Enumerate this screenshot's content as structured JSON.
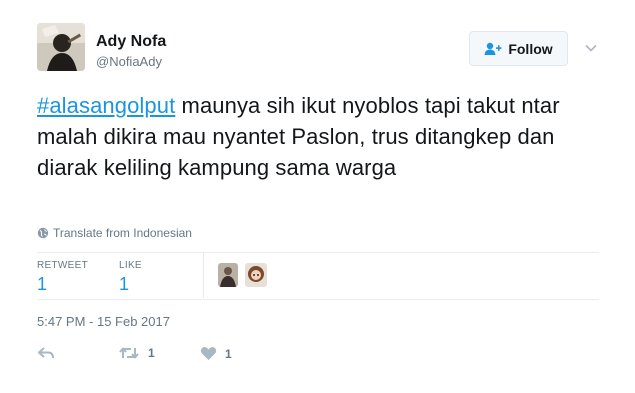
{
  "author": {
    "name": "Ady Nofa",
    "handle": "@NofiaAdy"
  },
  "follow_button": {
    "label": "Follow",
    "icon": "follow-user-icon"
  },
  "tweet": {
    "hashtag": "#alasangolput",
    "text": " maunya sih ikut nyoblos tapi takut ntar malah dikira mau nyantet Paslon, trus ditangkep dan diarak keliling kampung sama warga"
  },
  "translate": {
    "label": "Translate from Indonesian",
    "icon": "globe-icon"
  },
  "stats": {
    "retweet_label": "RETWEET",
    "retweet_count": "1",
    "like_label": "LIKE",
    "like_count": "1"
  },
  "timestamp": "5:47 PM - 15 Feb 2017",
  "actions": {
    "reply_icon": "reply-icon",
    "retweet_icon": "retweet-icon",
    "retweet_count": "1",
    "like_icon": "heart-icon",
    "like_count": "1"
  },
  "colors": {
    "link_blue": "#1b95e0",
    "text": "#14171a",
    "muted": "#657786",
    "action_gray": "#aab8c2"
  }
}
